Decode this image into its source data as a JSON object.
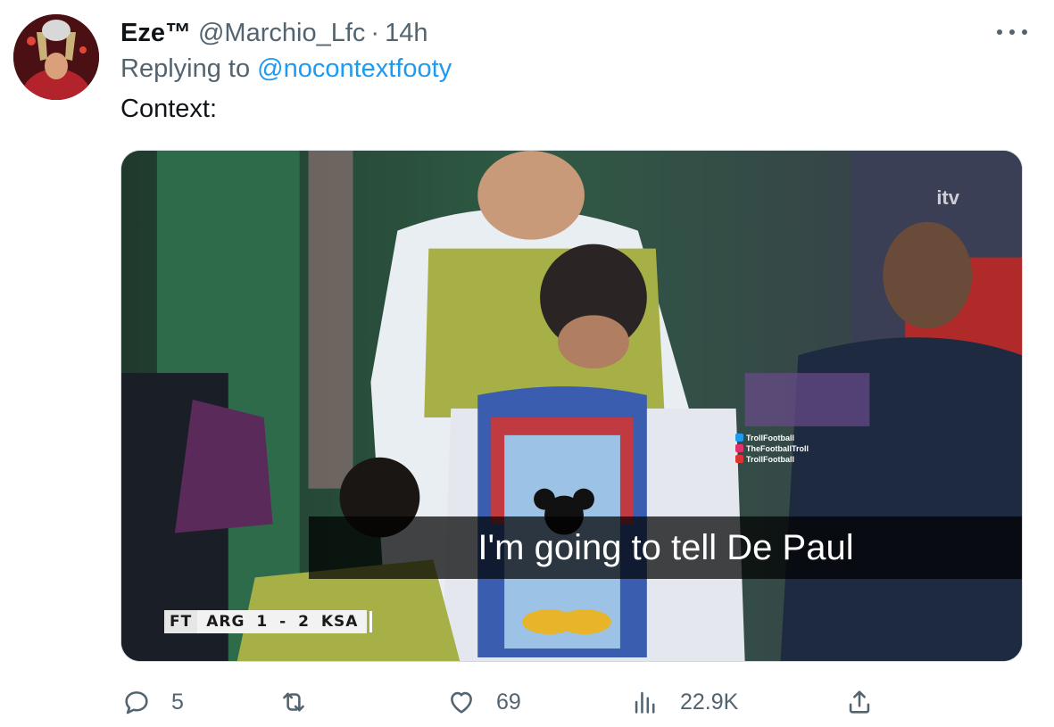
{
  "tweet": {
    "display_name": "Eze™",
    "handle": "@Marchio_Lfc",
    "separator": "·",
    "time": "14h",
    "replying_prefix": "Replying to ",
    "replying_to": "@nocontextfooty",
    "text": "Context:"
  },
  "media": {
    "subtitle": "I'm going to tell De Paul",
    "scorebug": {
      "status": "FT",
      "home": "ARG",
      "score": "1 - 2",
      "away": "KSA"
    },
    "broadcaster": "itv",
    "watermark": [
      "TrollFootball",
      "TheFootballTroll",
      "TrollFootball"
    ]
  },
  "actions": {
    "replies": "5",
    "retweets": "",
    "likes": "69",
    "views": "22.9K"
  },
  "colors": {
    "accent": "#1d9bf0",
    "secondary_text": "#536471",
    "primary_text": "#0f1419"
  },
  "icons": [
    "more-icon",
    "reply-icon",
    "retweet-icon",
    "like-icon",
    "views-icon",
    "share-icon"
  ]
}
